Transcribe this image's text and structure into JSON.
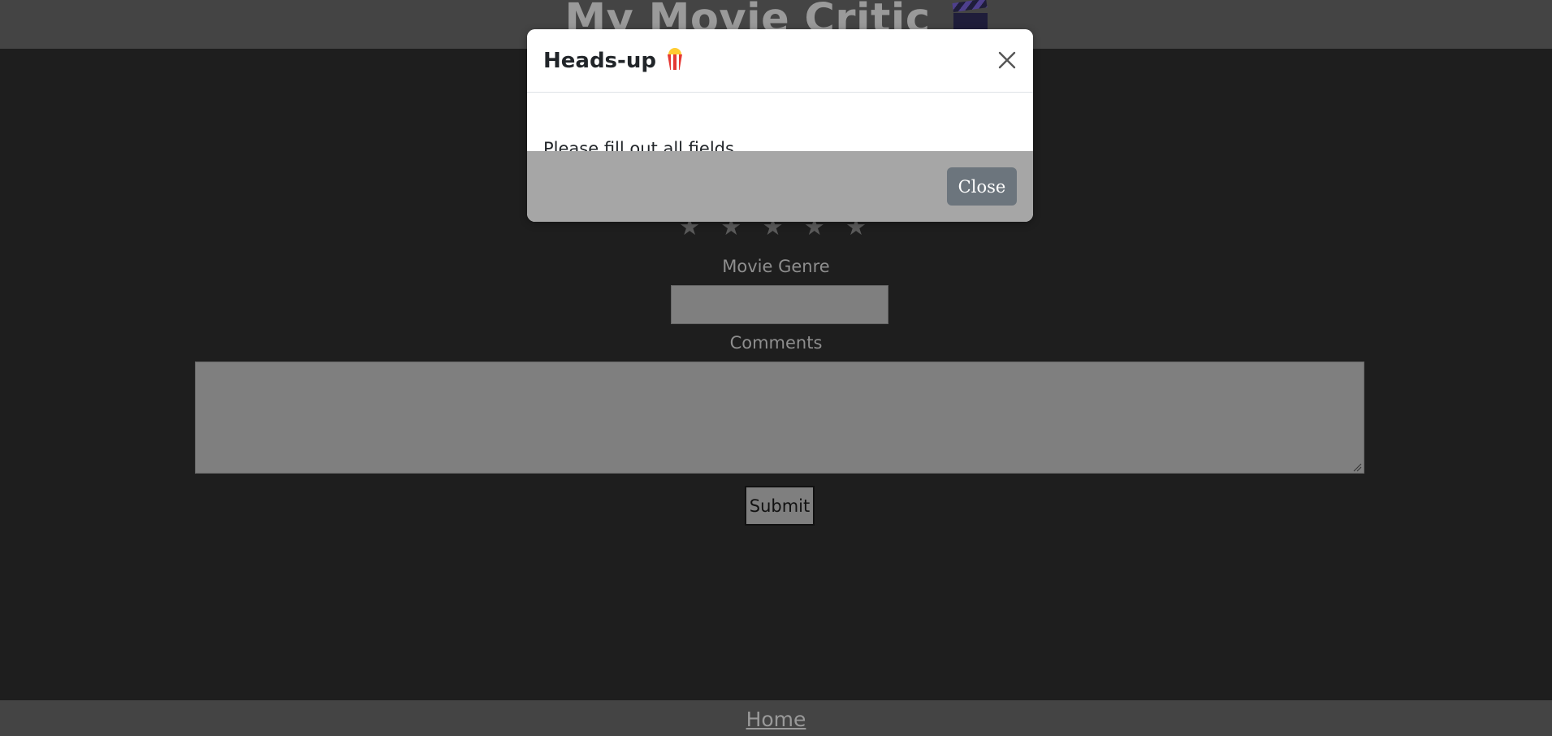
{
  "header": {
    "title": "My Movie Critic",
    "icon": "clapperboard-icon"
  },
  "form": {
    "rating": {
      "stars_total": 5,
      "stars_selected": 0,
      "star_glyph": "★"
    },
    "genre_label": "Movie Genre",
    "genre_value": "",
    "comments_label": "Comments",
    "comments_value": "",
    "submit_label": "Submit"
  },
  "footer": {
    "home_link": "Home"
  },
  "modal": {
    "title": "Heads-up",
    "title_icon": "popcorn-icon",
    "message": "Please fill out all fields.",
    "close_button": "Close",
    "close_icon": "close-icon"
  },
  "colors": {
    "page_background": "#1e1e1e",
    "header_background": "#444444",
    "modal_footer": "#a6a6a6",
    "close_button": "#6c757d"
  }
}
